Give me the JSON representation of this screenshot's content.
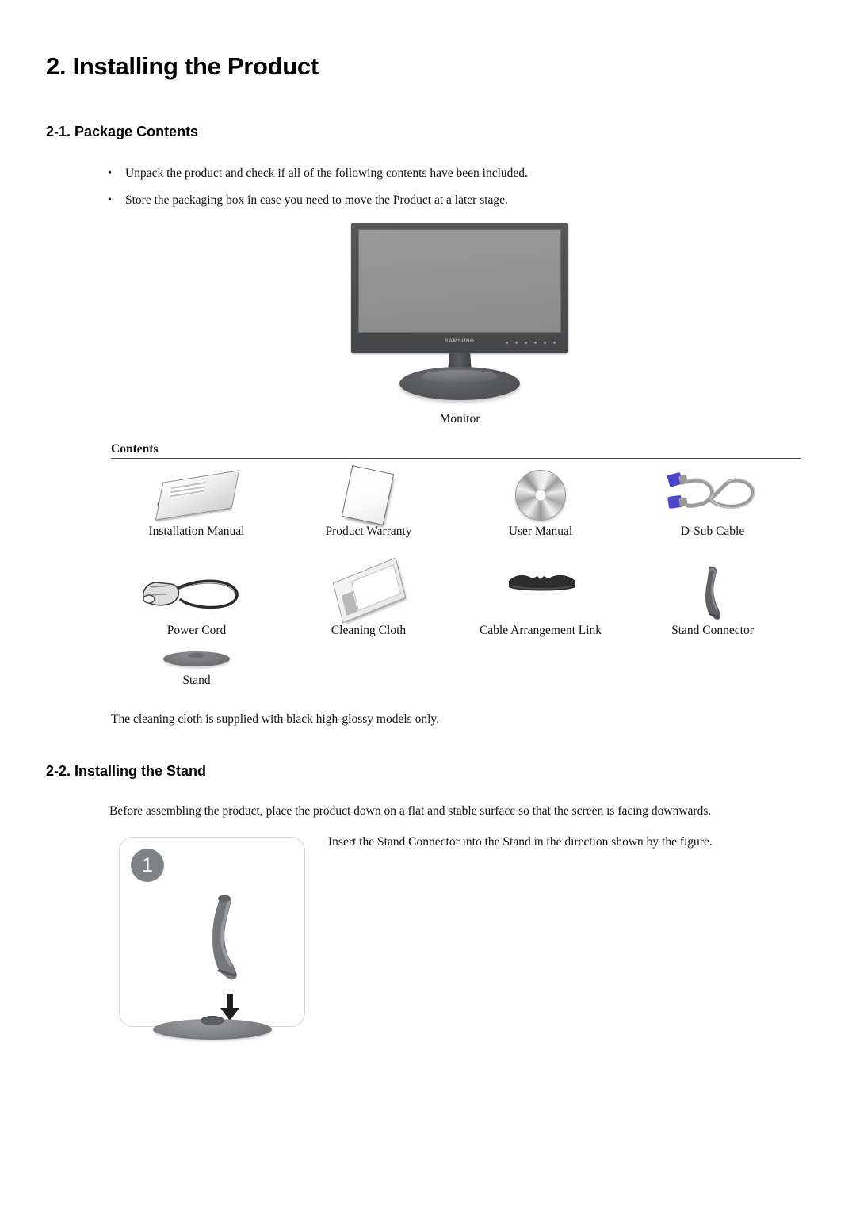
{
  "document": {
    "chapter_title": "2. Installing the Product",
    "sections": [
      {
        "id": "2-1",
        "heading": "2-1. Package Contents"
      },
      {
        "id": "2-2",
        "heading": "2-2. Installing the Stand"
      }
    ]
  },
  "package_contents": {
    "bullet_marker": "•",
    "bullets": [
      "Unpack the product and check if all of the following contents have been included.",
      "Store the packaging box in case you need to move the Product at a later stage."
    ],
    "monitor_caption": "Monitor",
    "monitor_logo": "SAMSUNG",
    "contents_label": "Contents",
    "items": [
      {
        "label": "Installation Manual",
        "icon": "installation-manual-icon"
      },
      {
        "label": "Product Warranty",
        "icon": "product-warranty-icon"
      },
      {
        "label": "User Manual",
        "icon": "user-manual-cd-icon"
      },
      {
        "label": "D-Sub Cable",
        "icon": "d-sub-cable-icon"
      },
      {
        "label": "Power Cord",
        "icon": "power-cord-icon"
      },
      {
        "label": "Cleaning Cloth",
        "icon": "cleaning-cloth-icon"
      },
      {
        "label": "Cable Arrangement Link",
        "icon": "cable-arrangement-link-icon"
      },
      {
        "label": "Stand Connector",
        "icon": "stand-connector-icon"
      },
      {
        "label": "Stand",
        "icon": "stand-icon"
      }
    ],
    "note": "The cleaning cloth is supplied with black high-glossy models only."
  },
  "installing_stand": {
    "intro": "Before assembling the product, place the product down on a flat and stable surface so that the screen is facing downwards.",
    "step_number": "1",
    "step_text": "Insert the Stand Connector into the Stand in the direction shown by the figure."
  },
  "colors": {
    "page_background": "#ffffff",
    "text": "#111111",
    "rule": "#4a4a4a",
    "monitor_bezel": "#4c4d4f",
    "monitor_screen": "#929292",
    "step_badge": "#7e8185",
    "step_box_border": "#d6d6d6",
    "connector_blue": "#4a46c8",
    "cable_gray": "#9b9b9b"
  }
}
